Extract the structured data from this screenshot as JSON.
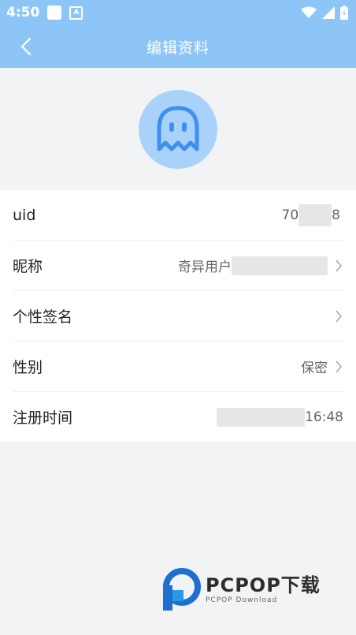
{
  "status_bar": {
    "time": "4:50",
    "indicator_letter": "A"
  },
  "header": {
    "title": "编辑资料"
  },
  "colors": {
    "accent": "#8ec5f7",
    "avatar_bg": "#a9d2fa",
    "ghost_icon": "#3d8ff0"
  },
  "profile": {
    "avatar_icon": "ghost-icon",
    "rows": [
      {
        "label": "uid",
        "value_visible_start": "70",
        "value_visible_end": "8"
      },
      {
        "label": "昵称",
        "value": "奇异用户"
      },
      {
        "label": "个性签名",
        "value": ""
      },
      {
        "label": "性别",
        "value": "保密"
      },
      {
        "label": "注册时间",
        "value_visible_end": "16:48"
      }
    ]
  },
  "watermark": {
    "brand": "PCPOP下载",
    "sub": "PCPOP Download"
  }
}
